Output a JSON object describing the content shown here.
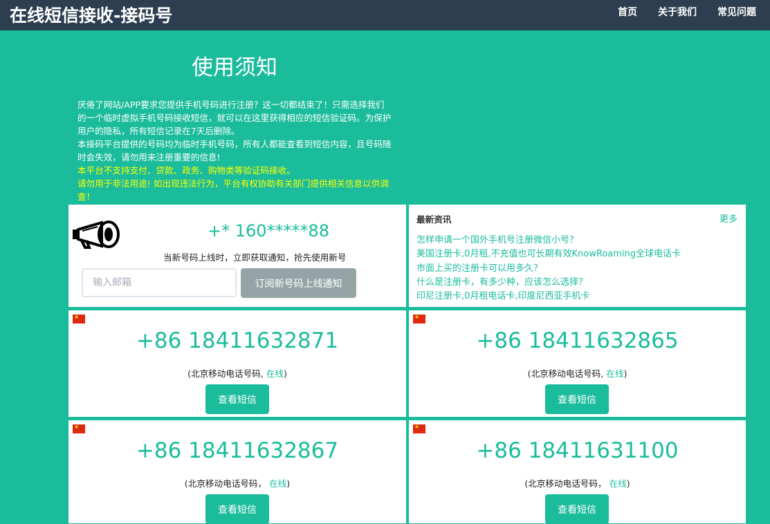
{
  "header": {
    "brand": "在线短信接收-接码号",
    "nav": [
      "首页",
      "关于我们",
      "常见问题"
    ]
  },
  "notice": {
    "title": "使用须知",
    "line1": "厌倦了网站/APP要求您提供手机号码进行注册？这一切都结束了！只需选择我们的一个临时虚拟手机号码接收短信，就可以在这里获得相应的短信验证码。为保护用户的隐私，所有短信记录在7天后删除。",
    "line2": "本接码平台提供的号码均为临时手机号码，所有人都能查看到短信内容，且号码随时会失效，请勿用来注册重要的信息!",
    "warn1": "本平台不支持支付、贷款、政务、购物类等验证码接收。",
    "warn2": "请勿用于非法用途! 如出现违法行为，平台有权协助有关部门提供相关信息以供调查！"
  },
  "subscribe": {
    "number": "+* 160*****88",
    "note": "当新号码上线时，立即获取通知，抢先使用新号",
    "email_placeholder": "输入邮箱",
    "button": "订阅新号码上线通知"
  },
  "news": {
    "title": "最新资讯",
    "more": "更多",
    "items": [
      "怎样申请一个国外手机号注册微信小号？",
      "美国注册卡,0月租,不充值也可长期有效KnowRoaming全球电话卡",
      "市面上买的注册卡可以用多久？",
      "什么是注册卡，有多少种，应该怎么选择？",
      "印尼注册卡,0月租电话卡,印度尼西亚手机卡"
    ]
  },
  "phones": [
    {
      "number": "+86 18411632871",
      "desc": "北京移动电话号码",
      "status": "在线",
      "button": "查看短信"
    },
    {
      "number": "+86 18411632865",
      "desc": "北京移动电话号码",
      "status": "在线",
      "button": "查看短信"
    },
    {
      "number": "+86 18411632867",
      "desc": "北京移动电话号码",
      "status": "在线",
      "button": "查看短信"
    },
    {
      "number": "+86 18411631100",
      "desc": "北京移动电话号码",
      "status": "在线",
      "button": "查看短信"
    }
  ],
  "colors": {
    "accent": "#1abc9c",
    "header": "#2c3e50",
    "warning": "#ffff00",
    "flag": "#de2910"
  }
}
